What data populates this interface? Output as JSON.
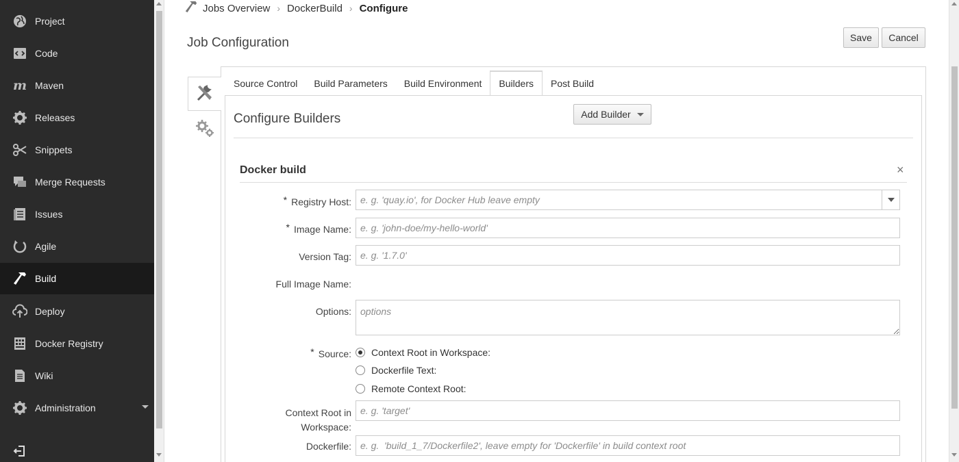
{
  "sidebar": {
    "items": [
      {
        "label": "Project",
        "icon": "globe-icon"
      },
      {
        "label": "Code",
        "icon": "code-icon"
      },
      {
        "label": "Maven",
        "icon": "maven-icon"
      },
      {
        "label": "Releases",
        "icon": "gear-icon"
      },
      {
        "label": "Snippets",
        "icon": "scissors-icon"
      },
      {
        "label": "Merge Requests",
        "icon": "merge-requests-icon"
      },
      {
        "label": "Issues",
        "icon": "issues-icon"
      },
      {
        "label": "Agile",
        "icon": "agile-icon"
      },
      {
        "label": "Build",
        "icon": "hammer-icon",
        "active": true
      },
      {
        "label": "Deploy",
        "icon": "cloud-upload-icon"
      },
      {
        "label": "Docker Registry",
        "icon": "docker-registry-icon"
      },
      {
        "label": "Wiki",
        "icon": "document-icon"
      },
      {
        "label": "Administration",
        "icon": "gear-icon"
      }
    ]
  },
  "breadcrumb": {
    "items": [
      "Jobs Overview",
      "DockerBuild",
      "Configure"
    ]
  },
  "page": {
    "title": "Job Configuration",
    "save_label": "Save",
    "cancel_label": "Cancel"
  },
  "tabs": [
    "Source Control",
    "Build Parameters",
    "Build Environment",
    "Builders",
    "Post Build"
  ],
  "active_tab": "Builders",
  "builders": {
    "title": "Configure Builders",
    "add_label": "Add Builder",
    "close_symbol": "×",
    "block": {
      "title": "Docker build",
      "registry_host": {
        "label": "Registry Host:",
        "placeholder": "e. g. 'quay.io', for Docker Hub leave empty"
      },
      "image_name": {
        "label": "Image Name:",
        "placeholder": "e. g. 'john-doe/my-hello-world'"
      },
      "version_tag": {
        "label": "Version Tag:",
        "placeholder": "e. g. '1.7.0'"
      },
      "full_image_name": {
        "label": "Full Image Name:"
      },
      "options": {
        "label": "Options:",
        "placeholder": "options"
      },
      "source": {
        "label": "Source:",
        "options": [
          "Context Root in Workspace:",
          "Dockerfile Text:",
          "Remote Context Root:"
        ],
        "selected": "Context Root in Workspace:"
      },
      "context_root": {
        "label_line1": "Context Root in",
        "label_line2": "Workspace:",
        "placeholder": "e. g. 'target'"
      },
      "dockerfile": {
        "label": "Dockerfile:",
        "placeholder": "e. g.  'build_1_7/Dockerfile2', leave empty for 'Dockerfile' in build context root"
      },
      "required_mark": "*"
    }
  }
}
